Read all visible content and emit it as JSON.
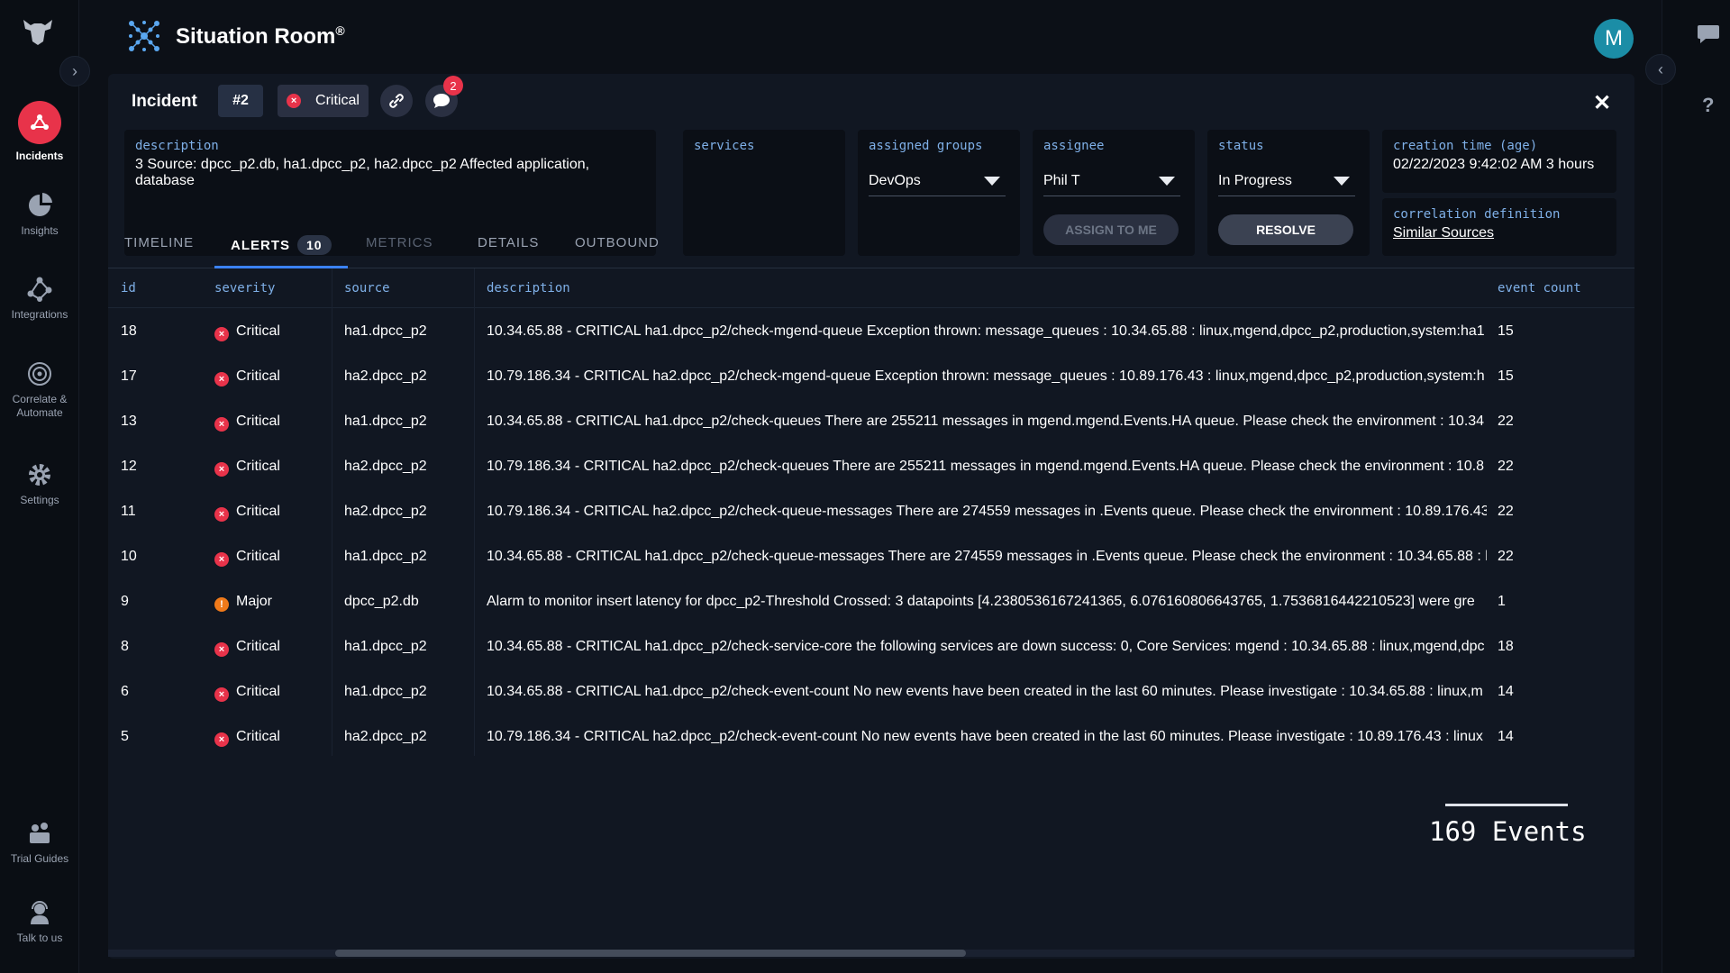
{
  "app": {
    "title": "Situation Room",
    "trademark": "®",
    "avatar_letter": "M"
  },
  "nav": {
    "items": [
      {
        "label": "Incidents",
        "icon": "incidents-icon"
      },
      {
        "label": "Insights",
        "icon": "pie-chart-icon"
      },
      {
        "label": "Integrations",
        "icon": "integrations-icon"
      },
      {
        "label": "Correlate &",
        "label2": "Automate",
        "icon": "target-icon"
      },
      {
        "label": "Settings",
        "icon": "gear-icon"
      },
      {
        "label": "Trial Guides",
        "icon": "guides-icon"
      },
      {
        "label": "Talk to us",
        "icon": "headset-icon"
      }
    ]
  },
  "incident": {
    "title": "Incident",
    "number": "#2",
    "severity": "Critical",
    "notification_count": "2",
    "description": {
      "label": "description",
      "value": "3 Source: dpcc_p2.db, ha1.dpcc_p2, ha2.dpcc_p2 Affected application, database"
    },
    "services": {
      "label": "services"
    },
    "assigned_groups": {
      "label": "assigned groups",
      "value": "DevOps"
    },
    "assignee": {
      "label": "assignee",
      "value": "Phil T",
      "button": "ASSIGN TO ME"
    },
    "status": {
      "label": "status",
      "value": "In Progress",
      "button": "RESOLVE"
    },
    "creation_time": {
      "label": "creation time (age)",
      "value": "02/22/2023 9:42:02 AM 3 hours"
    },
    "correlation": {
      "label": "correlation definition",
      "value": "Similar Sources"
    }
  },
  "tabs": {
    "timeline": "TIMELINE",
    "alerts": "ALERTS",
    "alerts_count": "10",
    "metrics": "METRICS",
    "details": "DETAILS",
    "outbound": "OUTBOUND"
  },
  "table": {
    "headers": {
      "id": "id",
      "severity": "severity",
      "source": "source",
      "description": "description",
      "event_count": "event count"
    },
    "rows": [
      {
        "id": "18",
        "severity": "Critical",
        "level": "critical",
        "source": "ha1.dpcc_p2",
        "description": "10.34.65.88 - CRITICAL ha1.dpcc_p2/check-mgend-queue Exception thrown: message_queues : 10.34.65.88 : linux,mgend,dpcc_p2,production,system:ha1",
        "count": "15"
      },
      {
        "id": "17",
        "severity": "Critical",
        "level": "critical",
        "source": "ha2.dpcc_p2",
        "description": "10.79.186.34 - CRITICAL ha2.dpcc_p2/check-mgend-queue Exception thrown: message_queues : 10.89.176.43 : linux,mgend,dpcc_p2,production,system:h",
        "count": "15"
      },
      {
        "id": "13",
        "severity": "Critical",
        "level": "critical",
        "source": "ha1.dpcc_p2",
        "description": "10.34.65.88 - CRITICAL ha1.dpcc_p2/check-queues There are 255211 messages in mgend.mgend.Events.HA queue. Please check the environment : 10.34",
        "count": "22"
      },
      {
        "id": "12",
        "severity": "Critical",
        "level": "critical",
        "source": "ha2.dpcc_p2",
        "description": "10.79.186.34 - CRITICAL ha2.dpcc_p2/check-queues There are 255211 messages in mgend.mgend.Events.HA queue. Please check the environment : 10.8",
        "count": "22"
      },
      {
        "id": "11",
        "severity": "Critical",
        "level": "critical",
        "source": "ha2.dpcc_p2",
        "description": "10.79.186.34 - CRITICAL ha2.dpcc_p2/check-queue-messages There are 274559 messages in .Events queue. Please check the environment : 10.89.176.43",
        "count": "22"
      },
      {
        "id": "10",
        "severity": "Critical",
        "level": "critical",
        "source": "ha1.dpcc_p2",
        "description": "10.34.65.88 - CRITICAL ha1.dpcc_p2/check-queue-messages There are 274559 messages in .Events queue. Please check the environment : 10.34.65.88 : l",
        "count": "22"
      },
      {
        "id": "9",
        "severity": "Major",
        "level": "major",
        "source": "dpcc_p2.db",
        "description": "Alarm to monitor insert latency for dpcc_p2-Threshold Crossed: 3 datapoints [4.2380536167241365, 6.076160806643765, 1.7536816442210523] were gre",
        "count": "1"
      },
      {
        "id": "8",
        "severity": "Critical",
        "level": "critical",
        "source": "ha1.dpcc_p2",
        "description": "10.34.65.88 - CRITICAL ha1.dpcc_p2/check-service-core the following services are down success: 0, Core Services: mgend : 10.34.65.88 : linux,mgend,dpc",
        "count": "18"
      },
      {
        "id": "6",
        "severity": "Critical",
        "level": "critical",
        "source": "ha1.dpcc_p2",
        "description": "10.34.65.88 - CRITICAL ha1.dpcc_p2/check-event-count No new events have been created in the last 60 minutes. Please investigate : 10.34.65.88 : linux,m",
        "count": "14"
      },
      {
        "id": "5",
        "severity": "Critical",
        "level": "critical",
        "source": "ha2.dpcc_p2",
        "description": "10.79.186.34 - CRITICAL ha2.dpcc_p2/check-event-count No new events have been created in the last 60 minutes. Please investigate : 10.89.176.43 : linux",
        "count": "14"
      }
    ],
    "total_events": "169 Events"
  },
  "colors": {
    "accent": "#3b82f6",
    "critical": "#e8334a",
    "major": "#f07a1a",
    "avatar": "#1b8da6"
  }
}
